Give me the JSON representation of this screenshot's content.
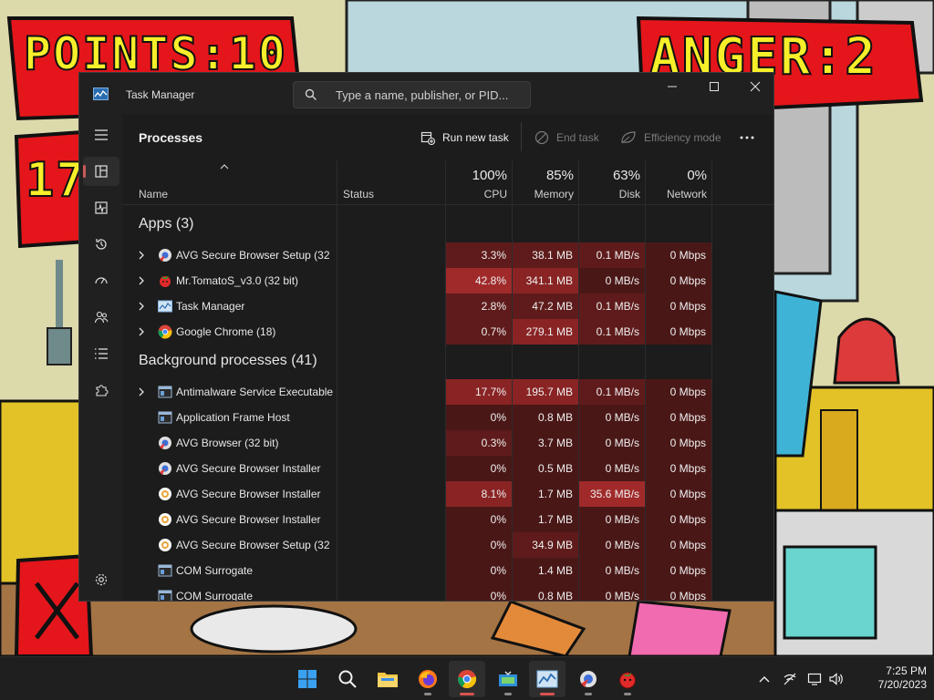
{
  "game": {
    "points_text": "POINTS:10",
    "anger_text": "ANGER:2",
    "timer_text": "17"
  },
  "window": {
    "title": "Task Manager",
    "search_placeholder": "Type a name, publisher, or PID..."
  },
  "toolbar": {
    "page_title": "Processes",
    "run_new_task": "Run new task",
    "end_task": "End task",
    "efficiency_mode": "Efficiency mode"
  },
  "columns": {
    "name": "Name",
    "status": "Status",
    "cpu_pct": "100%",
    "cpu": "CPU",
    "memory_pct": "85%",
    "memory": "Memory",
    "disk_pct": "63%",
    "disk": "Disk",
    "network_pct": "0%",
    "network": "Network"
  },
  "groups": {
    "apps": "Apps (3)",
    "background": "Background processes (41)"
  },
  "apps": [
    {
      "name": "AVG Secure Browser Setup (32 ...",
      "icon": "avg-browser-icon",
      "cpu": "3.3%",
      "memory": "38.1 MB",
      "disk": "0.1 MB/s",
      "network": "0 Mbps"
    },
    {
      "name": "Mr.TomatoS_v3.0 (32 bit)",
      "icon": "tomato-icon",
      "cpu": "42.8%",
      "memory": "341.1 MB",
      "disk": "0 MB/s",
      "network": "0 Mbps"
    },
    {
      "name": "Task Manager",
      "icon": "task-manager-icon",
      "cpu": "2.8%",
      "memory": "47.2 MB",
      "disk": "0.1 MB/s",
      "network": "0 Mbps"
    },
    {
      "name": "Google Chrome (18)",
      "icon": "chrome-icon",
      "cpu": "0.7%",
      "memory": "279.1 MB",
      "disk": "0.1 MB/s",
      "network": "0 Mbps"
    }
  ],
  "background": [
    {
      "name": "Antimalware Service Executable",
      "icon": "service-icon",
      "cpu": "17.7%",
      "memory": "195.7 MB",
      "disk": "0.1 MB/s",
      "network": "0 Mbps"
    },
    {
      "name": "Application Frame Host",
      "icon": "service-icon",
      "cpu": "0%",
      "memory": "0.8 MB",
      "disk": "0 MB/s",
      "network": "0 Mbps"
    },
    {
      "name": "AVG Browser (32 bit)",
      "icon": "avg-browser-icon",
      "cpu": "0.3%",
      "memory": "3.7 MB",
      "disk": "0 MB/s",
      "network": "0 Mbps"
    },
    {
      "name": "AVG Secure Browser Installer",
      "icon": "avg-browser-icon",
      "cpu": "0%",
      "memory": "0.5 MB",
      "disk": "0 MB/s",
      "network": "0 Mbps"
    },
    {
      "name": "AVG Secure Browser Installer",
      "icon": "avg-setup-icon",
      "cpu": "8.1%",
      "memory": "1.7 MB",
      "disk": "35.6 MB/s",
      "network": "0 Mbps"
    },
    {
      "name": "AVG Secure Browser Installer",
      "icon": "avg-setup-icon",
      "cpu": "0%",
      "memory": "1.7 MB",
      "disk": "0 MB/s",
      "network": "0 Mbps"
    },
    {
      "name": "AVG Secure Browser Setup (32 ...",
      "icon": "avg-setup-icon",
      "cpu": "0%",
      "memory": "34.9 MB",
      "disk": "0 MB/s",
      "network": "0 Mbps"
    },
    {
      "name": "COM Surrogate",
      "icon": "service-icon",
      "cpu": "0%",
      "memory": "1.4 MB",
      "disk": "0 MB/s",
      "network": "0 Mbps"
    },
    {
      "name": "COM Surrogate",
      "icon": "service-icon",
      "cpu": "0%",
      "memory": "0.8 MB",
      "disk": "0 MB/s",
      "network": "0 Mbps"
    }
  ],
  "taskbar": {
    "pinned": [
      "start-icon",
      "search-icon",
      "file-explorer-icon",
      "firefox-icon",
      "chrome-icon",
      "app-icon",
      "task-manager-icon",
      "avg-browser-icon",
      "tomato-icon"
    ],
    "time": "7:25 PM",
    "date": "7/20/2023"
  },
  "colors": {
    "heat_low": "#4a1717",
    "heat_mid": "#5f1b1b",
    "heat_high": "#8a2424",
    "heat_max": "#a02a2a",
    "accent": "#d9534f"
  }
}
